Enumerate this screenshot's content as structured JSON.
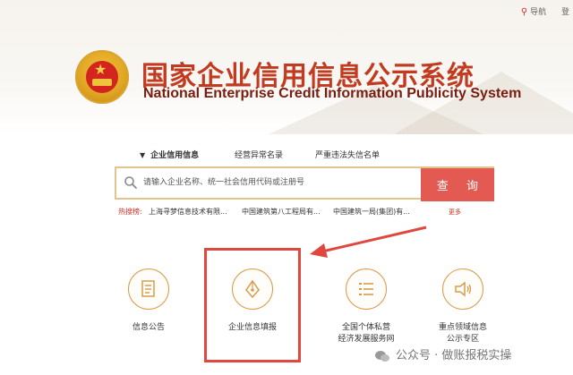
{
  "topbar": {
    "nav_label": "导航",
    "login_label": "登"
  },
  "header": {
    "title_cn": "国家企业信用信息公示系统",
    "title_en": "National Enterprise Credit Information Publicity System"
  },
  "tabs": [
    {
      "label": "企业信用信息",
      "active": true
    },
    {
      "label": "经营异常名录",
      "active": false
    },
    {
      "label": "严重违法失信名单",
      "active": false
    }
  ],
  "search": {
    "placeholder": "请输入企业名称、统一社会信用代码或注册号",
    "button_label": "查 询"
  },
  "hot_search": {
    "label": "热搜榜:",
    "items": [
      "上海寻梦信息技术有限...",
      "中国建筑第八工程局有...",
      "中国建筑一局(集团)有..."
    ],
    "more_label": "更多"
  },
  "services": [
    {
      "label": "信息公告",
      "icon": "document-icon"
    },
    {
      "label": "企业信息填报",
      "icon": "pen-nib-icon"
    },
    {
      "label_line1": "全国个体私营",
      "label_line2": "经济发展服务网",
      "icon": "list-icon"
    },
    {
      "label_line1": "重点领域信息",
      "label_line2": "公示专区",
      "icon": "speaker-icon"
    }
  ],
  "watermark": {
    "text": "公众号 · 做账报税实操"
  },
  "colors": {
    "accent_red": "#e25a52",
    "title_red": "#c23a1f",
    "icon_gold": "#d99b4a"
  }
}
